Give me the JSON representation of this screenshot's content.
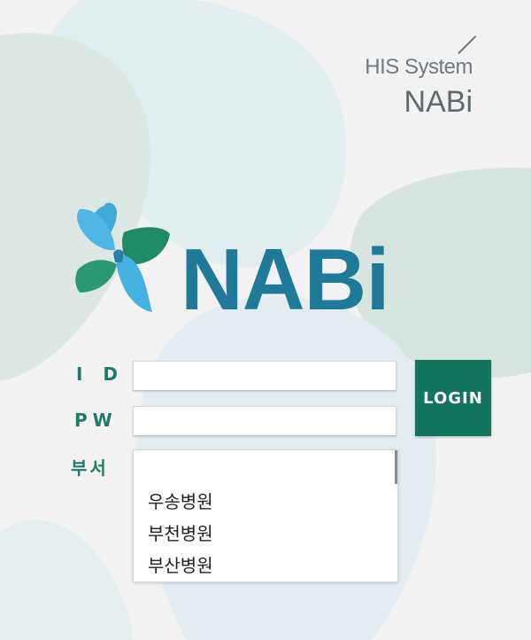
{
  "header": {
    "system_label": "HIS System",
    "system_name": "NABi"
  },
  "logo": {
    "text": "NABi",
    "icon": "butterfly-icon",
    "colors": {
      "wordmark": "#1f7a9a",
      "wing_blue": "#4fb6e6",
      "wing_green": "#1e8a66"
    }
  },
  "form": {
    "id_label": "I D",
    "pw_label": "PW",
    "dept_label": "부서",
    "id_value": "",
    "pw_value": "",
    "login_label": "LOGIN",
    "departments": [
      "우송병원",
      "부천병원",
      "부산병원"
    ]
  },
  "colors": {
    "accent": "#13755d",
    "label": "#1f7a6b"
  }
}
